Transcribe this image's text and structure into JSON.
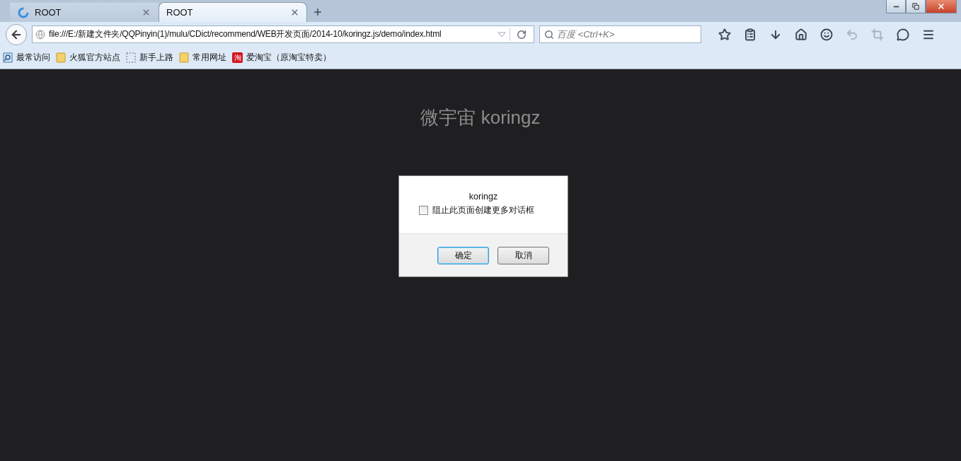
{
  "tabs": [
    {
      "label": "ROOT",
      "selected": false,
      "loading": true
    },
    {
      "label": "ROOT",
      "selected": true,
      "loading": false
    }
  ],
  "address": {
    "value": "file:///E:/新建文件夹/QQPinyin(1)/mulu/CDict/recommend/WEB开发页面/2014-10/koringz.js/demo/index.html"
  },
  "search": {
    "placeholder": "百度 <Ctrl+K>"
  },
  "toolbar": [
    {
      "kind": "star",
      "disabled": false
    },
    {
      "kind": "reader",
      "disabled": false
    },
    {
      "kind": "download",
      "disabled": false
    },
    {
      "kind": "home",
      "disabled": false
    },
    {
      "kind": "smile",
      "disabled": false
    },
    {
      "kind": "undo",
      "disabled": true
    },
    {
      "kind": "crop",
      "disabled": true
    },
    {
      "kind": "chat",
      "disabled": false
    },
    {
      "kind": "menu",
      "disabled": false
    }
  ],
  "bookmarks": [
    {
      "label": "最常访问",
      "kind": "recent"
    },
    {
      "label": "火狐官方站点",
      "kind": "folder"
    },
    {
      "label": "新手上路",
      "kind": "page"
    },
    {
      "label": "常用网址",
      "kind": "folder"
    },
    {
      "label": "爱淘宝（原淘宝特卖）",
      "kind": "badge",
      "badge": "淘"
    }
  ],
  "page": {
    "heading": "微宇宙 koringz"
  },
  "dialog": {
    "message": "koringz",
    "checkbox": {
      "label": "阻止此页面创建更多对话框",
      "checked": false
    },
    "buttons": [
      {
        "label": "确定",
        "default": true
      },
      {
        "label": "取消",
        "default": false
      }
    ]
  }
}
